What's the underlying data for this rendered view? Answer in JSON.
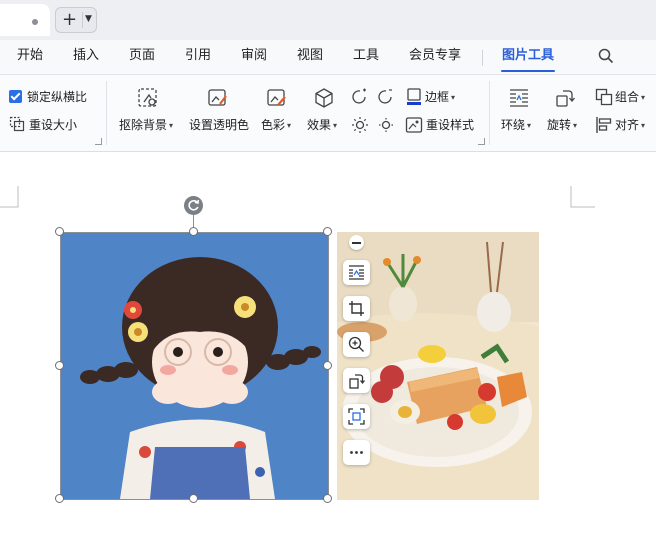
{
  "menu": {
    "items": [
      "开始",
      "插入",
      "页面",
      "引用",
      "审阅",
      "视图",
      "工具",
      "会员专享",
      "图片工具"
    ],
    "active": "图片工具"
  },
  "ribbon": {
    "lock_aspect": "锁定纵横比",
    "reset_size": "重设大小",
    "remove_bg": "抠除背景",
    "set_transparent": "设置透明色",
    "color": "色彩",
    "effects": "效果",
    "border": "边框",
    "reset_style": "重设样式",
    "wrap": "环绕",
    "rotate": "旋转",
    "group": "组合",
    "align": "对齐"
  },
  "lock_aspect_checked": true,
  "colors": {
    "accent": "#2b5fd9",
    "checkbox": "#2b6fe6",
    "border_icon_color": "#1a3ccf"
  },
  "icons": [
    "plus-icon",
    "chevron-down-icon",
    "search-icon",
    "remove-background-icon",
    "transparent-color-icon",
    "color-icon",
    "effects-icon",
    "brightness-up-icon",
    "contrast-icon",
    "border-icon",
    "reset-style-icon",
    "wrap-text-icon",
    "rotate-icon",
    "group-icon",
    "align-icon",
    "layout-icon",
    "crop-icon",
    "zoom-icon",
    "rotate-page-icon",
    "fit-icon",
    "more-icon",
    "rotate-handle-icon"
  ]
}
